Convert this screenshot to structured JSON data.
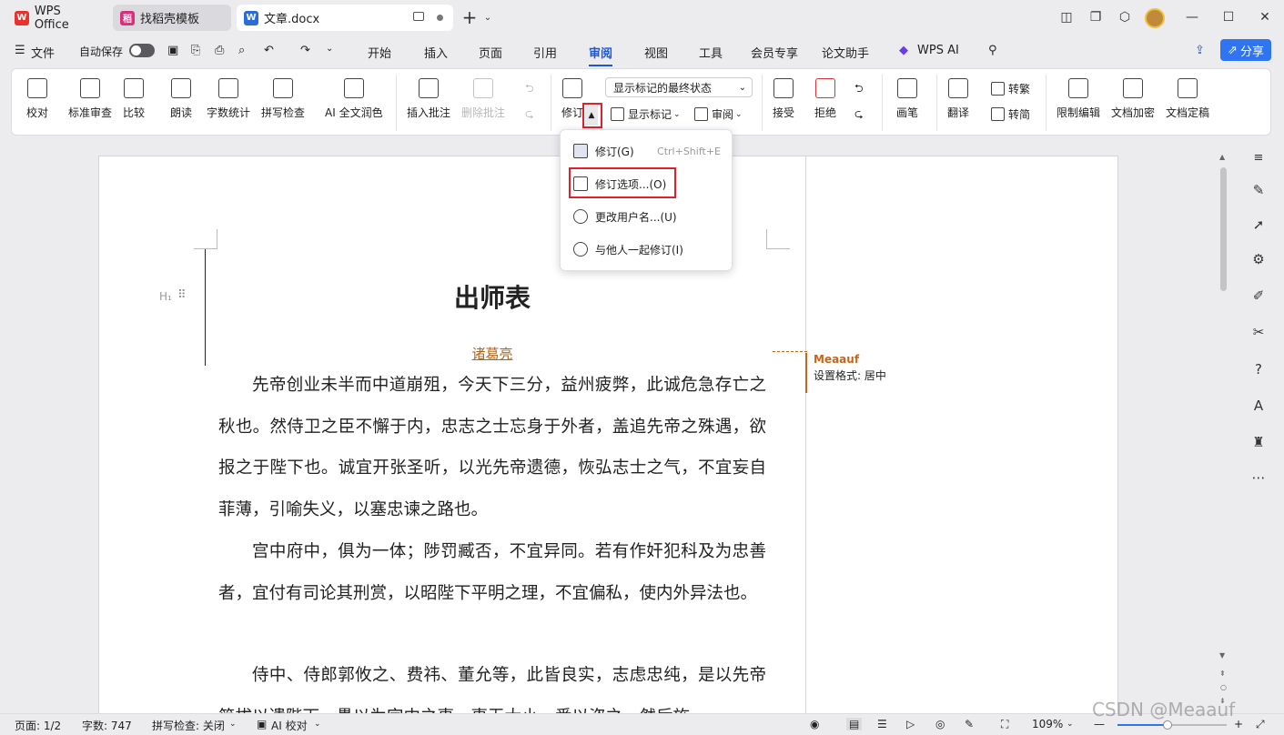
{
  "tabs": [
    {
      "label": "WPS Office",
      "icon": "wps-logo-icon"
    },
    {
      "label": "找稻壳模板",
      "icon": "docer-icon"
    },
    {
      "label": "文章.docx",
      "icon": "word-doc-icon"
    }
  ],
  "menu": {
    "file": "文件",
    "autosave": "自动保存",
    "items": [
      "开始",
      "插入",
      "页面",
      "引用",
      "审阅",
      "视图",
      "工具",
      "会员专享",
      "论文助手"
    ],
    "active": "审阅",
    "wps_ai": "WPS AI",
    "share": "分享"
  },
  "ribbon": {
    "proofread": "校对",
    "standard_review": "标准审查",
    "compare": "比较",
    "read_aloud": "朗读",
    "word_count": "字数统计",
    "spell_check": "拼写检查",
    "ai_polish": "AI 全文润色",
    "insert_comment": "插入批注",
    "delete_comment": "删除批注",
    "track_changes": "修订",
    "display_mode": "显示标记的最终状态",
    "show_markup": "显示标记",
    "review": "审阅",
    "accept": "接受",
    "reject": "拒绝",
    "ink": "画笔",
    "translate": "翻译",
    "to_traditional": "转繁",
    "to_simplified": "转简",
    "restrict_edit": "限制编辑",
    "encrypt": "文档加密",
    "finalize": "文档定稿"
  },
  "dropdown": {
    "items": [
      {
        "label": "修订(G)",
        "shortcut": "Ctrl+Shift+E"
      },
      {
        "label": "修订选项...(O)",
        "shortcut": ""
      },
      {
        "label": "更改用户名...(U)",
        "shortcut": ""
      },
      {
        "label": "与他人一起修订(I)",
        "shortcut": ""
      }
    ]
  },
  "document": {
    "heading_marker": "H₁",
    "title": "出师表",
    "author": "诸葛亮",
    "paragraphs": [
      "先帝创业未半而中道崩殂，今天下三分，益州疲弊，此诚危急存亡之秋也。然侍卫之臣不懈于内，忠志之士忘身于外者，盖追先帝之殊遇，欲报之于陛下也。诚宜开张圣听，以光先帝遗德，恢弘志士之气，不宜妄自菲薄，引喻失义，以塞忠谏之路也。",
      "宫中府中，俱为一体；陟罚臧否，不宜异同。若有作奸犯科及为忠善者，宜付有司论其刑赏，以昭陛下平明之理，不宜偏私，使内外异法也。",
      "侍中、侍郎郭攸之、费祎、董允等，此皆良实，志虑忠纯，是以先帝简拔以遗陛下。愚以为宫中之事，事无大小，悉以咨之，然后施"
    ]
  },
  "revision": {
    "author": "Meaauf",
    "text": "设置格式: 居中",
    "color": "#c8641a"
  },
  "status": {
    "page": "页面: 1/2",
    "words": "字数: 747",
    "spell": "拼写检查: 关闭",
    "ai_check": "AI 校对",
    "zoom": "109%"
  },
  "watermark": "CSDN @Meaauf",
  "colors": {
    "accent": "#1a57d6",
    "highlight": "#e0202a"
  }
}
